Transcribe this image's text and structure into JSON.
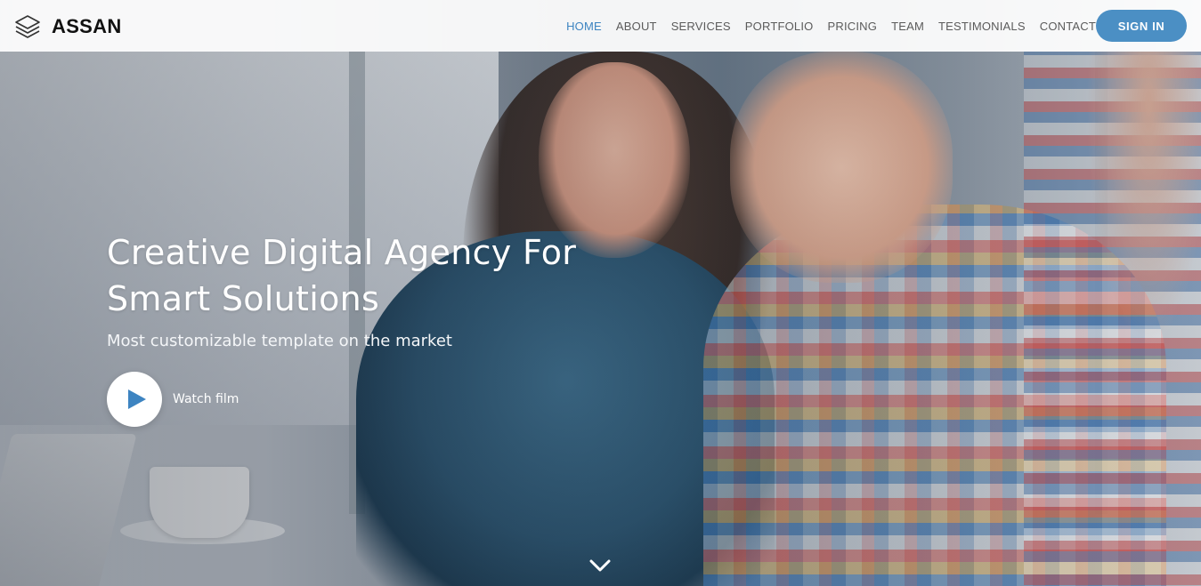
{
  "brand": {
    "name": "ASSAN",
    "logo_icon": "layers-icon"
  },
  "nav": {
    "items": [
      {
        "label": "HOME",
        "active": true
      },
      {
        "label": "ABOUT",
        "active": false
      },
      {
        "label": "SERVICES",
        "active": false
      },
      {
        "label": "PORTFOLIO",
        "active": false
      },
      {
        "label": "PRICING",
        "active": false
      },
      {
        "label": "TEAM",
        "active": false
      },
      {
        "label": "TESTIMONIALS",
        "active": false
      },
      {
        "label": "CONTACT",
        "active": false
      }
    ],
    "signin_label": "SIGN IN"
  },
  "hero": {
    "headline_line1": "Creative Digital Agency For",
    "headline_line2": "Smart Solutions",
    "subheadline": "Most customizable template on the market",
    "watch_label": "Watch film",
    "play_icon": "play-icon",
    "scroll_icon": "chevron-down-icon"
  },
  "colors": {
    "accent": "#3d84c1",
    "signin_bg": "#4b8fc4",
    "nav_text": "#5b5b5b",
    "brand_text": "#111111",
    "hero_text": "#ffffff"
  }
}
